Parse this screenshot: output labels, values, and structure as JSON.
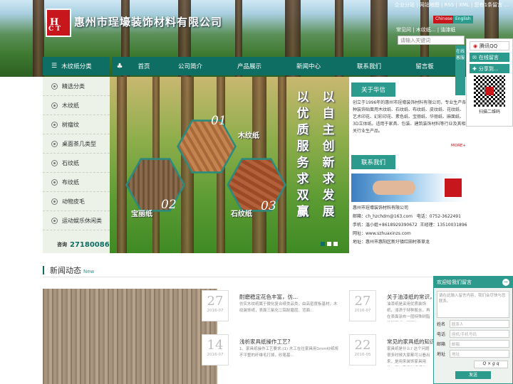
{
  "header": {
    "company_name": "惠州市珵壕装饰材料有限公司",
    "logo_letters_top": "H",
    "logo_letters_bottom": "C T",
    "top_links": "企业分站 | 网站地图 | RSS | XML | 您有1条留言 ...",
    "lang_cn": "Chinese",
    "lang_en": "English",
    "sub_links": "常见问 | 木纹纸... | 油漆纸",
    "search_placeholder": "请输入关键词"
  },
  "nav": {
    "categories_label": "木纹纸分类",
    "items": [
      "首页",
      "公司简介",
      "产品展示",
      "新闻中心",
      "联系我们",
      "留言板"
    ]
  },
  "sidebar": {
    "items": [
      "精选分类",
      "木纹纸",
      "树瘤纹",
      "桌面茶几类型",
      "石纹纸",
      "布纹纸",
      "动物皮毛",
      "运动娱乐休闲类"
    ],
    "hotline_label": "咨询",
    "hotline_number": "27180086"
  },
  "banner": {
    "hex": [
      {
        "num": "01",
        "label": "木纹纸"
      },
      {
        "num": "02",
        "label": "宝丽纸"
      },
      {
        "num": "03",
        "label": "石纹纸"
      }
    ],
    "slogan_left": "以优质服务求双赢",
    "slogan_right": "以自主创新求发展"
  },
  "about": {
    "tab": "关于华信",
    "text": "创立于1996年的惠州市珵壕装饰材料有限公司，专业生产各种装饰贴面用木纹纸、石纹纸、布纹纸、皮纹纸、花纹纸、艺术印花、幻彩印花、素色纸、宝丽纸、华丽纸、麻面纸、3D立体纸。适用于家具、包装、建筑装饰材料等行业及其相关行业生产品。",
    "more": "MORE+"
  },
  "contact": {
    "tab": "联系我们",
    "company": "惠州市珵壕装饰材料有限公司",
    "email_label": "邮箱：",
    "email": "ch_hzchdm@163.com",
    "phone_label": "电话：",
    "phone": "0752-3622491",
    "mobile_label": "手机：",
    "mobile": "温小姐+8618929390672",
    "mobile2_label": "王经理：",
    "mobile2": "13510031896",
    "web_label": "网址：",
    "web": "www.szhuaxinzs.com",
    "addr_label": "地址：",
    "addr": "惠州市惠阳区新圩镇红田村茶草龙"
  },
  "float": {
    "qq": "腾讯QQ",
    "online_msg": "在线留言",
    "share": "分享到...",
    "scan": "扫描二维码",
    "side_tab": "在线客服"
  },
  "news": {
    "title": "新闻动态",
    "sub": "New",
    "items": [
      {
        "day": "27",
        "ym": "2016-07",
        "title": "耐磨稳定花色丰富，仿...",
        "sum": "仿实木纹纸属于微化复合纸类品类，由高密度板基材，木纹装饰纸，表面三氧化二铝耐磨层、背面..."
      },
      {
        "day": "27",
        "ym": "2016-07",
        "title": "关于油漆纸的常识，你...",
        "sum": "油漆纸是采用优质装饰纸，浸渍于特种胶水，再在表面涂布一层特殊树脂涂料而成，既可以..."
      },
      {
        "day": "14",
        "ym": "2016-07",
        "title": "浅析家具纸操作工艺?",
        "sum": "1、家具纸操作工艺要求:(1) 木工在往家具用1mm纱纸将不平整的纤维毛打掉，砂笔基..."
      },
      {
        "day": "22",
        "ym": "2016-05",
        "title": "常见的家具纸的知识，...",
        "sum": "家具纸是什么? 这个问题很多时候大家都可以看出来，是用来装饰家具用的。可以产于装饰纸的一种..."
      }
    ]
  },
  "message": {
    "title": "欢迎给我们留言",
    "close": "−",
    "placeholder": "请在此输入留言内容，我们会尽快与您联系。",
    "name_label": "姓名",
    "name_ph": "联系人",
    "phone_label": "电话",
    "phone_ph": "座机/手机号码",
    "email_label": "邮箱",
    "email_ph": "邮箱",
    "addr_label": "地址",
    "addr_ph": "地址",
    "captcha": "Q × g q",
    "send": "发送"
  },
  "colors": {
    "brand_green": "#0f6e63",
    "accent_teal": "#2c9a8c",
    "logo_red": "#c8171c"
  }
}
